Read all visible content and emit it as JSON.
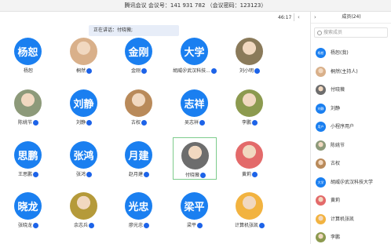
{
  "title": "腾讯会议 会议号：141 931 782 （会议密码：123123）",
  "timer": "46:17",
  "speaking": "正在讲话：付晓薇;",
  "colors": {
    "accent_blue": "#1a7ff0",
    "mic_blue": "#1d63e8",
    "active_border": "#7dcc8c"
  },
  "tiles": [
    {
      "avatar_text": "杨恕",
      "caption": "杨恕",
      "photo": false,
      "mic": false,
      "color": "#1a7ff0"
    },
    {
      "avatar_text": "",
      "caption": "桐然",
      "photo": true,
      "mic": true,
      "color": "#d9b08a"
    },
    {
      "avatar_text": "金刚",
      "caption": "金刚",
      "photo": false,
      "mic": true,
      "color": "#1a7ff0"
    },
    {
      "avatar_text": "大学",
      "caption": "胡威＠武汉科技...",
      "photo": false,
      "mic": true,
      "color": "#1a7ff0"
    },
    {
      "avatar_text": "",
      "caption": "刘小明",
      "photo": true,
      "mic": true,
      "color": "#8a7a5a"
    },
    {
      "avatar_text": "",
      "caption": "陈姚节",
      "photo": true,
      "mic": true,
      "color": "#8d9a7a"
    },
    {
      "avatar_text": "刘静",
      "caption": "刘静",
      "photo": false,
      "mic": true,
      "color": "#1a7ff0"
    },
    {
      "avatar_text": "",
      "caption": "古权",
      "photo": true,
      "mic": true,
      "color": "#b98a5a"
    },
    {
      "avatar_text": "志祥",
      "caption": "吴志祥",
      "photo": false,
      "mic": true,
      "color": "#1a7ff0"
    },
    {
      "avatar_text": "",
      "caption": "李鹏",
      "photo": true,
      "mic": true,
      "color": "#8c9a4f"
    },
    {
      "avatar_text": "思鹏",
      "caption": "王思鹏",
      "photo": false,
      "mic": true,
      "color": "#1a7ff0"
    },
    {
      "avatar_text": "张鸿",
      "caption": "张鸿",
      "photo": false,
      "mic": true,
      "color": "#1a7ff0"
    },
    {
      "avatar_text": "月建",
      "caption": "赵月建",
      "photo": false,
      "mic": true,
      "color": "#1a7ff0"
    },
    {
      "avatar_text": "",
      "caption": "付晓薇",
      "photo": true,
      "mic": true,
      "color": "#6d6d6d"
    },
    {
      "avatar_text": "",
      "caption": "黄莉",
      "photo": true,
      "mic": true,
      "color": "#e36a6a"
    },
    {
      "avatar_text": "晓龙",
      "caption": "张晓龙",
      "photo": false,
      "mic": true,
      "color": "#1a7ff0"
    },
    {
      "avatar_text": "",
      "caption": "余志兵",
      "photo": true,
      "mic": true,
      "color": "#b59a3a"
    },
    {
      "avatar_text": "光忠",
      "caption": "廖光忠",
      "photo": false,
      "mic": true,
      "color": "#1a7ff0"
    },
    {
      "avatar_text": "梁平",
      "caption": "梁平",
      "photo": false,
      "mic": true,
      "color": "#1a7ff0"
    },
    {
      "avatar_text": "",
      "caption": "计算机张凯",
      "photo": true,
      "mic": true,
      "color": "#f2b340"
    }
  ],
  "sidebar": {
    "header": "成员(24)",
    "search_placeholder": "搜索成员",
    "members": [
      {
        "avatar_text": "杨恕",
        "name": "杨恕(我)",
        "color": "#1a7ff0"
      },
      {
        "avatar_text": "",
        "name": "桐然(主持人)",
        "color": "#d9b08a"
      },
      {
        "avatar_text": "",
        "name": "付晓薇",
        "color": "#6d6d6d"
      },
      {
        "avatar_text": "刘静",
        "name": "刘静",
        "color": "#1a7ff0"
      },
      {
        "avatar_text": "用户",
        "name": "小程序用户",
        "color": "#1a7ff0"
      },
      {
        "avatar_text": "",
        "name": "陈姚节",
        "color": "#8d9a7a"
      },
      {
        "avatar_text": "",
        "name": "古权",
        "color": "#b98a5a"
      },
      {
        "avatar_text": "大学",
        "name": "胡威＠武汉科技大学",
        "color": "#1a7ff0"
      },
      {
        "avatar_text": "",
        "name": "黄莉",
        "color": "#e36a6a"
      },
      {
        "avatar_text": "",
        "name": "计算机张凯",
        "color": "#f2b340"
      },
      {
        "avatar_text": "",
        "name": "李鹏",
        "color": "#8c9a4f"
      }
    ]
  }
}
